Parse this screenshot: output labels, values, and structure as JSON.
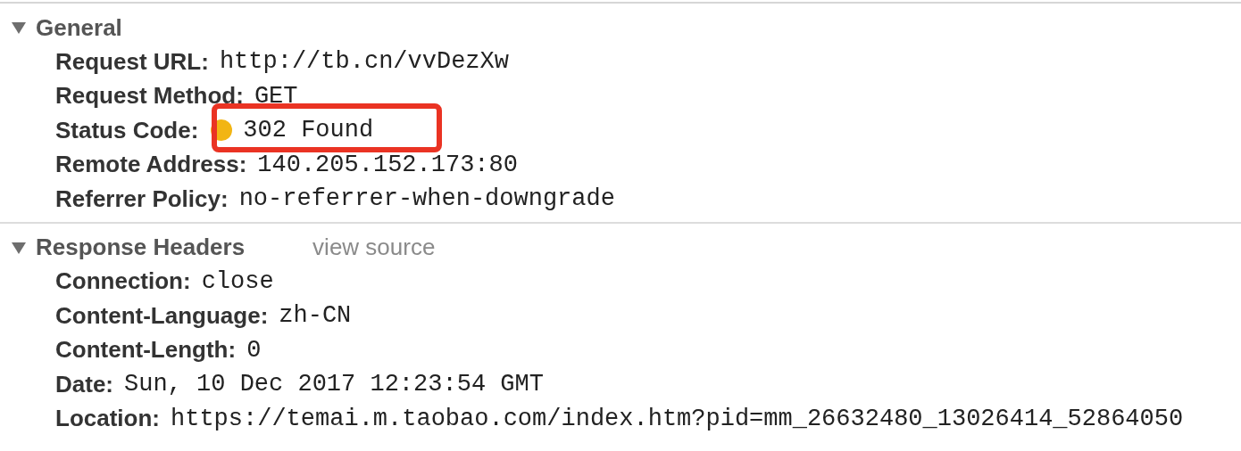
{
  "sections": [
    {
      "title": "General",
      "expanded": true,
      "rows": [
        {
          "key": "Request URL:",
          "value": "http://tb.cn/vvDezXw"
        },
        {
          "key": "Request Method:",
          "value": "GET"
        },
        {
          "key": "Status Code:",
          "value": "302 Found",
          "color": "#f2b514",
          "highlighted": true
        },
        {
          "key": "Remote Address:",
          "value": "140.205.152.173:80"
        },
        {
          "key": "Referrer Policy:",
          "value": "no-referrer-when-downgrade"
        }
      ]
    },
    {
      "title": "Response Headers",
      "expanded": true,
      "link": "view source",
      "rows": [
        {
          "key": "Connection:",
          "value": "close"
        },
        {
          "key": "Content-Language:",
          "value": "zh-CN"
        },
        {
          "key": "Content-Length:",
          "value": "0"
        },
        {
          "key": "Date:",
          "value": "Sun, 10 Dec 2017 12:23:54 GMT"
        },
        {
          "key": "Location:",
          "value": "https://temai.m.taobao.com/index.htm?pid=mm_26632480_13026414_52864050"
        }
      ]
    }
  ]
}
